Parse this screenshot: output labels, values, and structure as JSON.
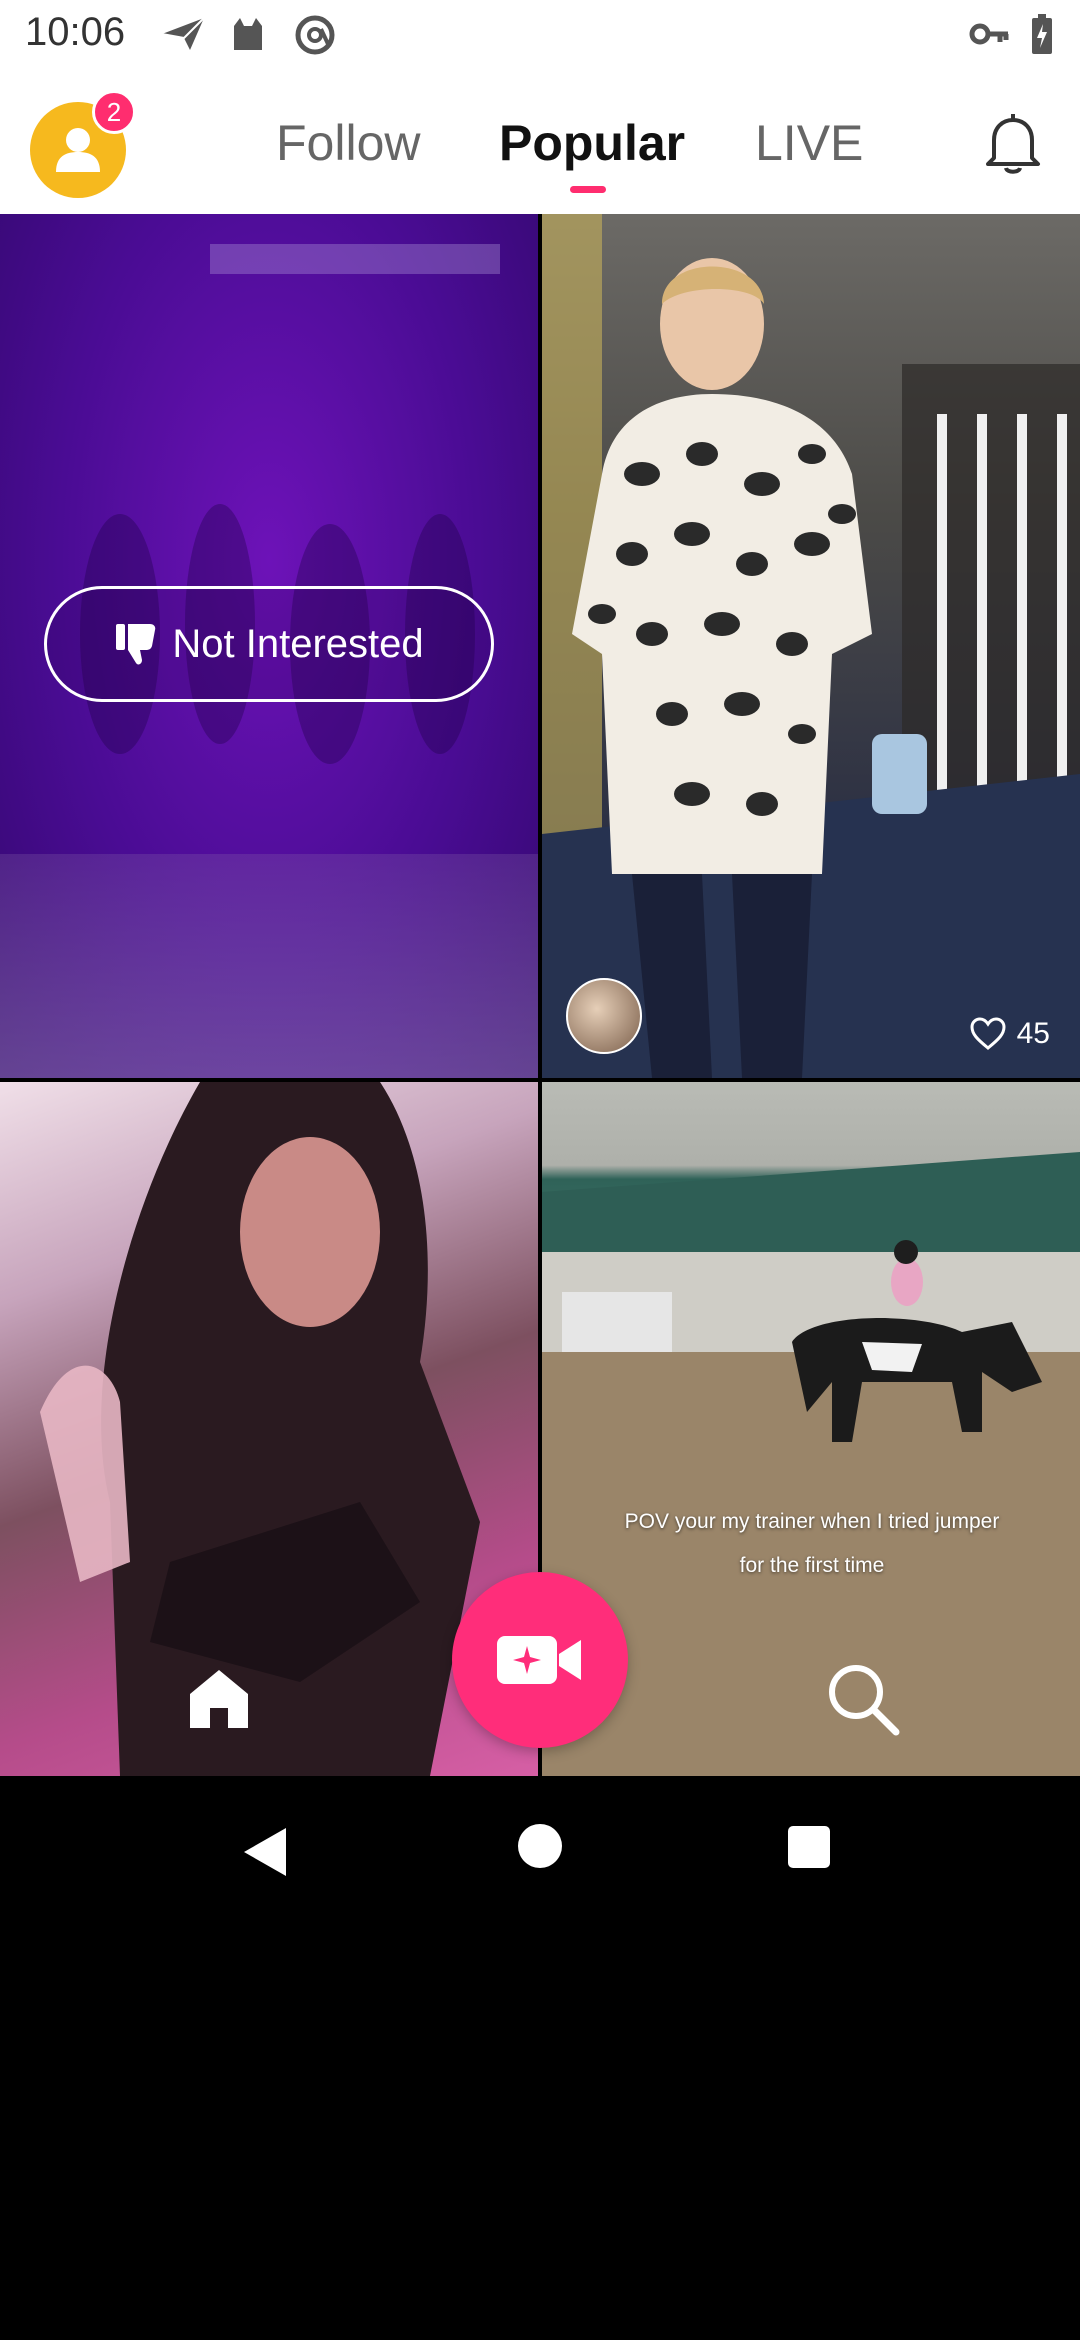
{
  "status_bar": {
    "time": "10:06",
    "left_icons": [
      "send-icon",
      "cat-icon",
      "at-icon"
    ],
    "right_icons": [
      "key-icon",
      "battery-charging-icon"
    ]
  },
  "header": {
    "notification_badge": "2",
    "tabs": [
      {
        "label": "Follow",
        "active": false
      },
      {
        "label": "Popular",
        "active": true
      },
      {
        "label": "LIVE",
        "active": false
      }
    ],
    "accent_color": "#FF2D6F"
  },
  "feed": {
    "cell1": {
      "not_interested_label": "Not Interested"
    },
    "cell2": {
      "likes": "45"
    },
    "cell4": {
      "caption_line1": "POV your my trainer when I tried jumper",
      "caption_line2": "for the first time"
    }
  },
  "bottom_nav": {
    "items": [
      "home-icon",
      "record-video-icon",
      "search-icon"
    ],
    "record_color": "#FF2D7A"
  }
}
